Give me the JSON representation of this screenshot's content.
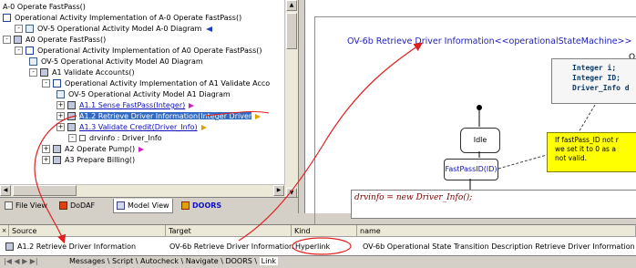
{
  "tree": {
    "rows": [
      {
        "label": "A-0 Operate FastPass()"
      },
      {
        "label": "Operational Activity Implementation of A-0 Operate FastPass()"
      },
      {
        "label": "OV-5 Operational Activity Model A-0 Diagram"
      },
      {
        "label": "A0 Operate FastPass()"
      },
      {
        "label": "Operational Activity Implementation of A0 Operate FastPass()"
      },
      {
        "label": "OV-5 Operational Activity Model A0 Diagram"
      },
      {
        "label": "A1 Validate Accounts()"
      },
      {
        "label": "Operational Activity Implementation of A1 Validate Acco"
      },
      {
        "label": "OV-5 Operational Activity Model A1 Diagram"
      },
      {
        "label": "A1.1 Sense FastPass(Integer)"
      },
      {
        "label": "A1.2 Retrieve Driver Information(Integer Driver"
      },
      {
        "label": "A1.3 Validate Credit(Driver_Info)"
      },
      {
        "label": "drvinfo : Driver_Info"
      },
      {
        "label": "A2 Operate Pump()"
      },
      {
        "label": "A3 Prepare Billing()"
      }
    ]
  },
  "tabs": [
    {
      "label": "File View"
    },
    {
      "label": "DoDAF"
    },
    {
      "label": "Model View"
    },
    {
      "label": "DOORS"
    }
  ],
  "diagram": {
    "title": "OV-6b Retrieve Driver Information<<operationalStateMachine>>",
    "code_lines": [
      "Integer i;",
      "Integer ID;",
      "Driver_Info d"
    ],
    "state_idle": "Idle",
    "state_fastpass": "FastPassID(ID)",
    "note_lines": [
      "If fastPass_ID not r",
      "we set it to 0 as a",
      "not valid."
    ],
    "assign_text": "drvinfo = new Driver_Info();",
    "o_label": "O"
  },
  "table": {
    "headers": [
      "Source",
      "Target",
      "Kind",
      "name"
    ],
    "row": {
      "source": "A1.2 Retrieve Driver Information",
      "target": "OV-6b Retrieve Driver Information",
      "kind": "Hyperlink",
      "name": "OV-6b Operational State Transition Description  Retrieve Driver Information"
    }
  },
  "bottom_tabs": [
    "Messages",
    "Script",
    "Autocheck",
    "Navigate",
    "DOORS",
    "Link"
  ],
  "colors": {
    "accent": "#316ac5",
    "arrow": "#e02020",
    "link": "#1010c0",
    "note": "#ffff00"
  }
}
